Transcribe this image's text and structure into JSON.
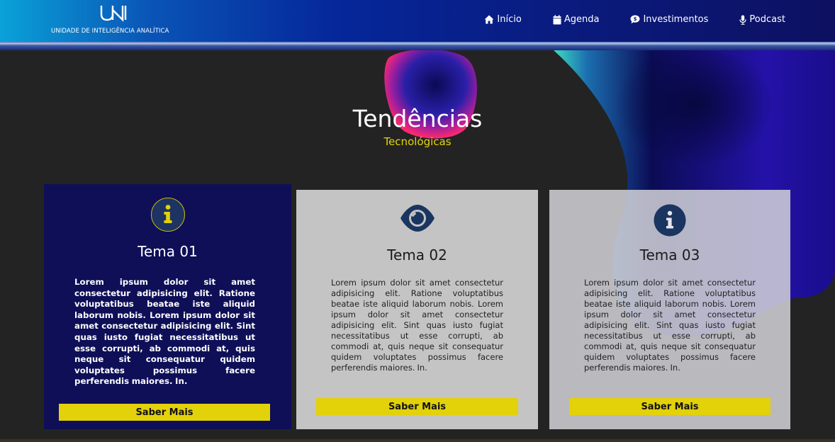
{
  "header": {
    "logo_mark": "UNI",
    "logo_text": "UNIDADE DE INTELIGÊNCIA ANALÍTICA",
    "nav": [
      {
        "label": "Início",
        "icon": "home-icon"
      },
      {
        "label": "Agenda",
        "icon": "calendar-icon"
      },
      {
        "label": "Investimentos",
        "icon": "comment-dollar-icon"
      },
      {
        "label": "Podcast",
        "icon": "microphone-icon"
      }
    ]
  },
  "hero": {
    "title": "Tendências",
    "subtitle": "Tecnológicas"
  },
  "cards": [
    {
      "icon": "info-circle-icon",
      "title": "Tema 01",
      "body": "Lorem ipsum dolor sit amet consectetur adipisicing elit. Ratione voluptatibus beatae iste aliquid laborum nobis. Lorem ipsum dolor sit amet consectetur adipisicing elit. Sint quas iusto fugiat necessitatibus ut esse corrupti, ab commodi at, quis neque sit consequatur quidem voluptates possimus facere perferendis maiores. In.",
      "button": "Saber Mais"
    },
    {
      "icon": "eye-icon",
      "title": "Tema 02",
      "body": "Lorem ipsum dolor sit amet consectetur adipisicing elit. Ratione voluptatibus beatae iste aliquid laborum nobis. Lorem ipsum dolor sit amet consectetur adipisicing elit. Sint quas iusto fugiat necessitatibus ut esse corrupti, ab commodi at, quis neque sit consequatur quidem voluptates possimus facere perferendis maiores. In.",
      "button": "Saber Mais"
    },
    {
      "icon": "info-circle-icon",
      "title": "Tema 03",
      "body": "Lorem ipsum dolor sit amet consectetur adipisicing elit. Ratione voluptatibus beatae iste aliquid laborum nobis. Lorem ipsum dolor sit amet consectetur adipisicing elit. Sint quas iusto fugiat necessitatibus ut esse corrupti, ab commodi at, quis neque sit consequatur quidem voluptates possimus facere perferendis maiores. In.",
      "button": "Saber Mais"
    }
  ],
  "colors": {
    "accent_yellow": "#e3d10a",
    "card_dark": "#0e0f57",
    "card_light": "#c4c4c4",
    "icon_navy": "#1a3560",
    "background": "#232323"
  }
}
